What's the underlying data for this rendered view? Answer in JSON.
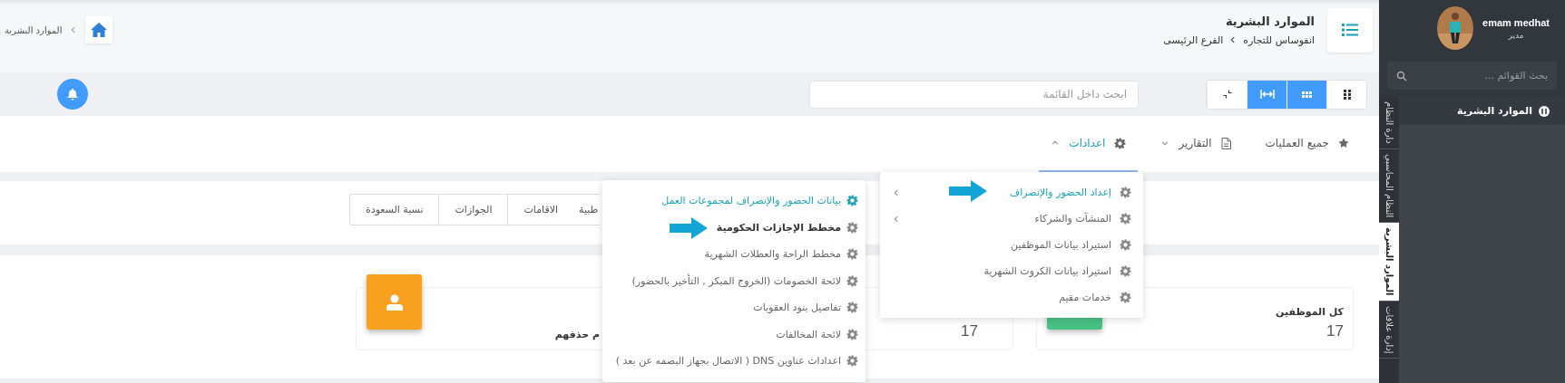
{
  "sidebar": {
    "user": {
      "name": "emam medhat",
      "role": "مدير"
    },
    "search": {
      "placeholder": "بحث القوائم ..."
    },
    "items": [
      {
        "label": "الموارد البشرية"
      }
    ],
    "module_tabs": [
      {
        "label": "دارة النظام",
        "selected": false
      },
      {
        "label": "النظام المحاسبي",
        "selected": false
      },
      {
        "label": "الموارد البشرية",
        "selected": true
      },
      {
        "label": "إدارة علاقات",
        "selected": false
      }
    ]
  },
  "header": {
    "title": "الموارد البشرية",
    "breadcrumb": [
      "انفوساس للتجاره",
      "الفرع الرئيسى"
    ],
    "trail": [
      "الموارد البشرية"
    ]
  },
  "toolbar": {
    "view_buttons": [
      {
        "kind": "grid-small",
        "on": false
      },
      {
        "kind": "grid-wide",
        "on": true
      },
      {
        "kind": "expand",
        "on": true
      },
      {
        "kind": "compress",
        "on": false
      }
    ],
    "search": {
      "placeholder": "ابحث داخل القائمة"
    }
  },
  "nav": [
    {
      "label": "جميع العمليات",
      "kind": "star",
      "has_menu": false,
      "selected": false
    },
    {
      "label": "التقارير",
      "kind": "report",
      "has_menu": true,
      "expanded": false,
      "selected": false
    },
    {
      "label": "اعدادات",
      "kind": "settings",
      "has_menu": true,
      "expanded": true,
      "selected": true
    }
  ],
  "settings_menu": {
    "items": [
      {
        "label": "إعداد الحضور والإنصراف",
        "selected": true,
        "submenu": true,
        "pointer": true
      },
      {
        "label": "المنشآت والشركاء",
        "selected": false,
        "submenu": true,
        "pointer": false
      },
      {
        "label": "استيراد بيانات الموظفين",
        "selected": false,
        "submenu": false,
        "pointer": false
      },
      {
        "label": "استيراد بيانات الكروت الشهرية",
        "selected": false,
        "submenu": false,
        "pointer": false
      },
      {
        "label": "خدمات مقيم",
        "selected": false,
        "submenu": false,
        "pointer": false
      }
    ]
  },
  "submenu": {
    "items": [
      {
        "label": "بيانات الحضور والإنصراف لمجموعات العمل",
        "selected": true,
        "hovered": false,
        "pointer": false
      },
      {
        "label": "مخطط الإجازات الحكومية",
        "selected": false,
        "hovered": true,
        "pointer": true
      },
      {
        "label": "مخطط الراحة والعطلات الشهرية",
        "selected": false,
        "hovered": false,
        "pointer": false
      },
      {
        "label": "لائحة الخصومات (الخروج المبكر , التأخير بالحضور)",
        "selected": false,
        "hovered": false,
        "pointer": false
      },
      {
        "label": "تفاصيل بنود العقوبات",
        "selected": false,
        "hovered": false,
        "pointer": false
      },
      {
        "label": "لائحة المخالفات",
        "selected": false,
        "hovered": false,
        "pointer": false
      },
      {
        "label": "اعدادات عناوين DNS ( الاتصال بجهاز البصمه عن بعد )",
        "selected": false,
        "hovered": false,
        "pointer": false
      }
    ]
  },
  "report_tabs": [
    "طبية",
    "الاقامات",
    "الجوازات",
    "نسبة السعودة"
  ],
  "stats": [
    {
      "label": "كل الموظفين",
      "value": "17",
      "color": "#48c283"
    },
    {
      "value": "17"
    },
    {
      "label": "م حذفهم",
      "color": "#f7a11f"
    }
  ]
}
